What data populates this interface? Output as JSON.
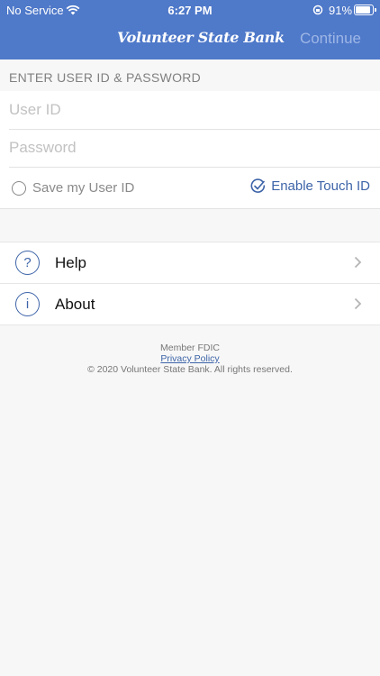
{
  "status_bar": {
    "carrier": "No Service",
    "time": "6:27 PM",
    "battery": "91%"
  },
  "nav": {
    "logo_text": "Volunteer State Bank",
    "continue_label": "Continue"
  },
  "form": {
    "section_label": "ENTER USER ID & PASSWORD",
    "user_id_placeholder": "User ID",
    "password_placeholder": "Password",
    "save_user_id_label": "Save my User ID",
    "enable_touch_id_label": "Enable Touch ID"
  },
  "menu": {
    "items": [
      {
        "label": "Help",
        "icon": "question-icon"
      },
      {
        "label": "About",
        "icon": "info-icon"
      }
    ]
  },
  "footer": {
    "member": "Member FDIC",
    "privacy": "Privacy Policy",
    "copyright": "© 2020 Volunteer State Bank. All rights reserved."
  },
  "colors": {
    "header": "#4f79c9",
    "accent": "#3d64a8"
  }
}
